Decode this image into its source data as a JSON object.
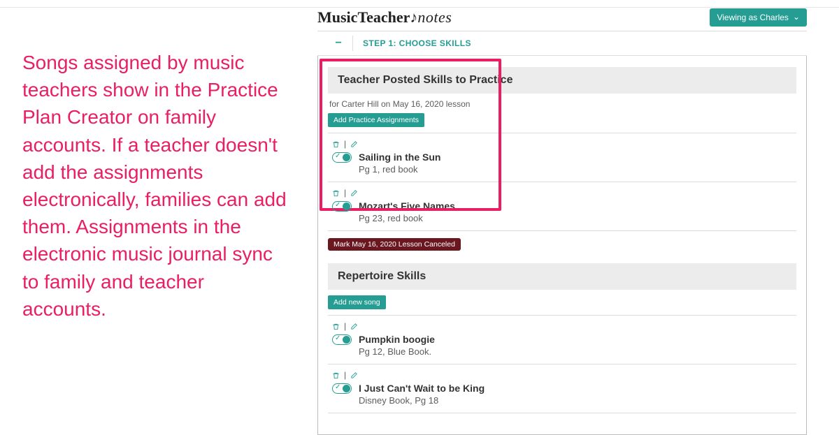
{
  "explainer": "Songs assigned by music teachers show in the Practice Plan Creator on family accounts. If a teacher doesn't add the assignments electronically, families can add them. Assignments in the electronic music journal sync to family and teacher accounts.",
  "logo": {
    "brand": "MusicTeacher",
    "suffix": "notes"
  },
  "viewing": {
    "label": "Viewing as Charles"
  },
  "step": {
    "title": "STEP 1: CHOOSE SKILLS"
  },
  "teacherSection": {
    "header": "Teacher Posted Skills to Practice",
    "subline": "for Carter Hill on May 16, 2020 lesson",
    "addBtn": "Add Practice Assignments",
    "skills": [
      {
        "title": "Sailing in the Sun",
        "sub": "Pg 1, red book"
      },
      {
        "title": "Mozart's Five Names",
        "sub": "Pg 23, red book"
      }
    ]
  },
  "markPill": "Mark May 16, 2020 Lesson Canceled",
  "repertoireSection": {
    "header": "Repertoire Skills",
    "addBtn": "Add new song",
    "skills": [
      {
        "title": "Pumpkin boogie",
        "sub": "Pg 12, Blue Book."
      },
      {
        "title": "I Just Can't Wait to be King",
        "sub": "Disney Book, Pg 18"
      }
    ]
  }
}
